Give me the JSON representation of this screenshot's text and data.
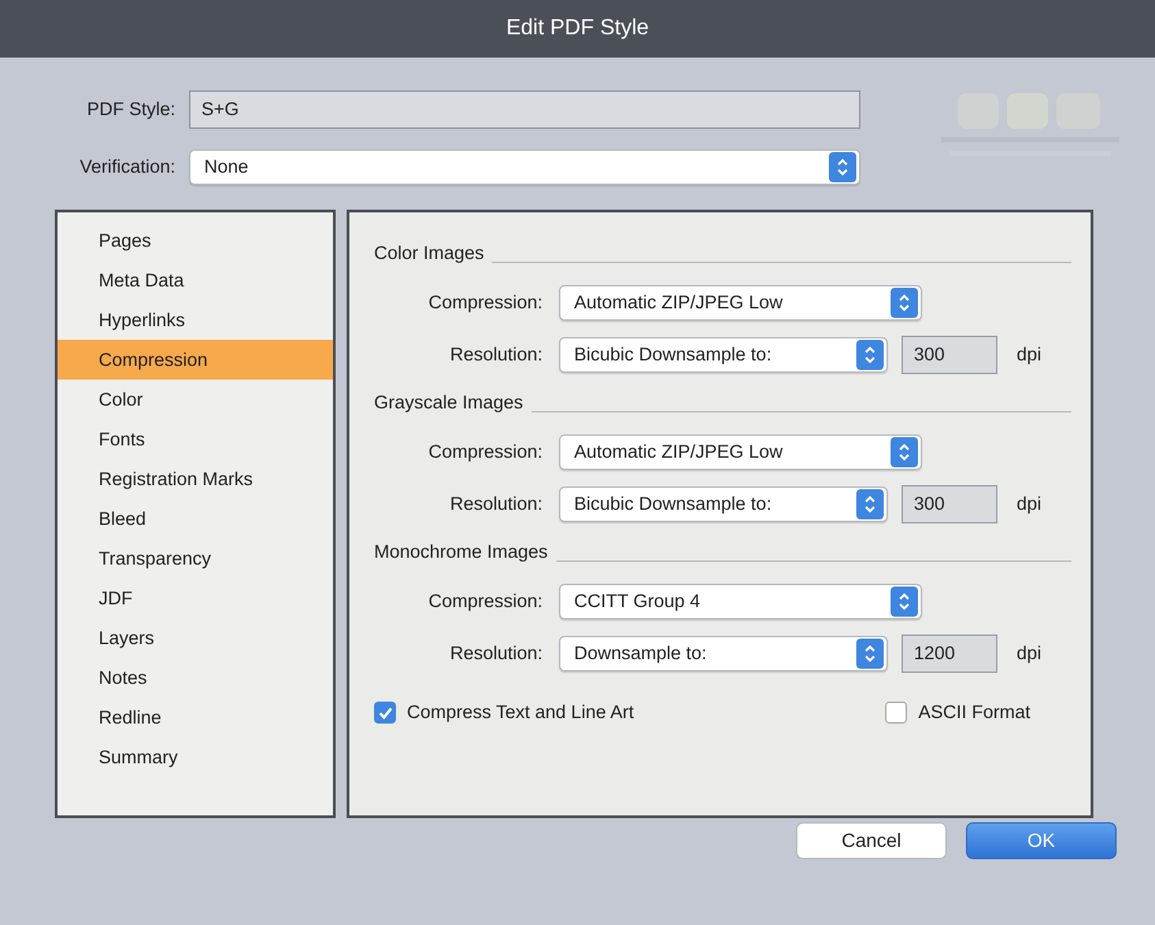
{
  "window": {
    "title": "Edit PDF Style"
  },
  "pdf_style": {
    "label": "PDF Style:",
    "value": "S+G"
  },
  "verification": {
    "label": "Verification:",
    "value": "None"
  },
  "sidebar": {
    "items": [
      {
        "label": "Pages",
        "selected": false
      },
      {
        "label": "Meta Data",
        "selected": false
      },
      {
        "label": "Hyperlinks",
        "selected": false
      },
      {
        "label": "Compression",
        "selected": true
      },
      {
        "label": "Color",
        "selected": false
      },
      {
        "label": "Fonts",
        "selected": false
      },
      {
        "label": "Registration Marks",
        "selected": false
      },
      {
        "label": "Bleed",
        "selected": false
      },
      {
        "label": "Transparency",
        "selected": false
      },
      {
        "label": "JDF",
        "selected": false
      },
      {
        "label": "Layers",
        "selected": false
      },
      {
        "label": "Notes",
        "selected": false
      },
      {
        "label": "Redline",
        "selected": false
      },
      {
        "label": "Summary",
        "selected": false
      }
    ]
  },
  "sections": [
    {
      "title": "Color Images",
      "compression": {
        "label": "Compression:",
        "value": "Automatic ZIP/JPEG Low"
      },
      "resolution": {
        "label": "Resolution:",
        "value": "Bicubic Downsample to:",
        "dpi": "300",
        "unit": "dpi"
      }
    },
    {
      "title": "Grayscale Images",
      "compression": {
        "label": "Compression:",
        "value": "Automatic ZIP/JPEG Low"
      },
      "resolution": {
        "label": "Resolution:",
        "value": "Bicubic Downsample to:",
        "dpi": "300",
        "unit": "dpi"
      }
    },
    {
      "title": "Monochrome Images",
      "compression": {
        "label": "Compression:",
        "value": "CCITT Group 4"
      },
      "resolution": {
        "label": "Resolution:",
        "value": "Downsample to:",
        "dpi": "1200",
        "unit": "dpi"
      }
    }
  ],
  "options": [
    {
      "label": "Compress Text and Line Art",
      "checked": true
    },
    {
      "label": "ASCII Format",
      "checked": false
    }
  ],
  "buttons": [
    {
      "label": "Cancel",
      "kind": "default"
    },
    {
      "label": "OK",
      "kind": "primary"
    }
  ]
}
